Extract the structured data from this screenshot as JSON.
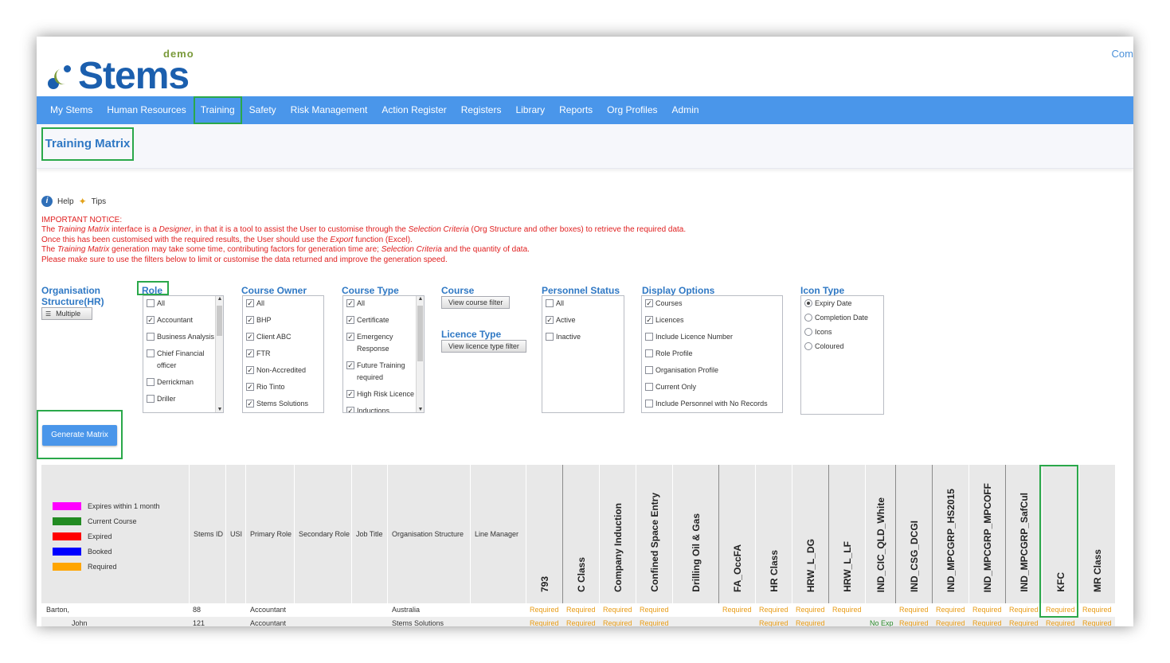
{
  "header": {
    "logo_text": "Stems",
    "logo_tag": "demo",
    "top_right": "Com"
  },
  "nav": {
    "items": [
      "My Stems",
      "Human Resources",
      "Training",
      "Safety",
      "Risk Management",
      "Action Register",
      "Registers",
      "Library",
      "Reports",
      "Org Profiles",
      "Admin"
    ],
    "active": "Training"
  },
  "page": {
    "title": "Training Matrix"
  },
  "help": {
    "help_label": "Help",
    "tips_label": "Tips"
  },
  "notice": {
    "heading": "IMPORTANT NOTICE:",
    "l1a": "The ",
    "l1b": "Training Matrix",
    "l1c": " interface is a ",
    "l1d": "Designer",
    "l1e": ", in that it is a tool to assist the User to customise through the ",
    "l1f": "Selection Criteria",
    "l1g": " (Org Structure and other boxes) to retrieve the required data.",
    "l2a": "Once this has been customised with the required results, the User should use the ",
    "l2b": "Export",
    "l2c": " function (Excel).",
    "l3a": "The ",
    "l3b": "Training Matrix",
    "l3c": " generation may take some time, contributing factors for generation time are; ",
    "l3d": "Selection Criteria",
    "l3e": " and the quantity of data.",
    "l4": "Please make sure to use the filters below to limit or customise the data returned and improve the generation speed."
  },
  "filters": {
    "org_label_1": "Organisation",
    "org_label_2": "Structure(HR)",
    "org_button": "Multiple",
    "role_label": "Role",
    "role_options": [
      "All",
      "Accountant",
      "Business Analysis",
      "Chief Financial officer",
      "Derrickman",
      "Driller"
    ],
    "course_owner_label": "Course Owner",
    "course_owner_options": [
      "All",
      "BHP",
      "Client ABC",
      "FTR",
      "Non-Accredited",
      "Rio Tinto",
      "Stems Solutions"
    ],
    "course_type_label": "Course Type",
    "course_type_options": [
      "All",
      "Certificate",
      "Emergency Response",
      "Future Training required",
      "High Risk Licence",
      "Inductions"
    ],
    "course_label": "Course",
    "course_button": "View course filter",
    "licence_label": "Licence Type",
    "licence_button": "View licence type filter",
    "personnel_label": "Personnel Status",
    "personnel_options": [
      "All",
      "Active",
      "Inactive"
    ],
    "display_label": "Display Options",
    "display_options": [
      "Courses",
      "Licences",
      "Include Licence Number",
      "Role Profile",
      "Organisation Profile",
      "Current Only",
      "Include Personnel with No Records"
    ],
    "icon_label": "Icon Type",
    "icon_options": [
      "Expiry Date",
      "Completion Date",
      "Icons",
      "Coloured"
    ],
    "generate_button": "Generate Matrix"
  },
  "legend": [
    {
      "label": "Expires within 1 month",
      "color": "#ff00ff"
    },
    {
      "label": "Current Course",
      "color": "#228b22"
    },
    {
      "label": "Expired",
      "color": "#ff0000"
    },
    {
      "label": "Booked",
      "color": "#0000ff"
    },
    {
      "label": "Required",
      "color": "#ffa500"
    }
  ],
  "matrix": {
    "info_headers": [
      "Stems ID",
      "USI",
      "Primary Role",
      "Secondary Role",
      "Job Title",
      "Organisation Structure",
      "Line Manager"
    ],
    "course_headers": [
      "793",
      "C Class",
      "Company Induction",
      "Confined Space Entry",
      "Drilling Oil & Gas",
      "FA_OccFA",
      "HR Class",
      "HRW_L_DG",
      "HRW_L_LF",
      "IND_CIC_QLD_White",
      "IND_CSG_DCGI",
      "IND_MPCGRP_HS2015",
      "IND_MPCGRP_MPCOFF",
      "IND_MPCGRP_SafCul",
      "KFC",
      "MR Class"
    ],
    "row1": {
      "name": "Barton,",
      "id": "88",
      "role": "Accountant",
      "org": "Australia",
      "required": "Required"
    },
    "row2": {
      "name": "John",
      "id": "121",
      "role": "Accountant",
      "org": "Stems Solutions",
      "required": "Required",
      "nofx": "No Exp"
    }
  }
}
